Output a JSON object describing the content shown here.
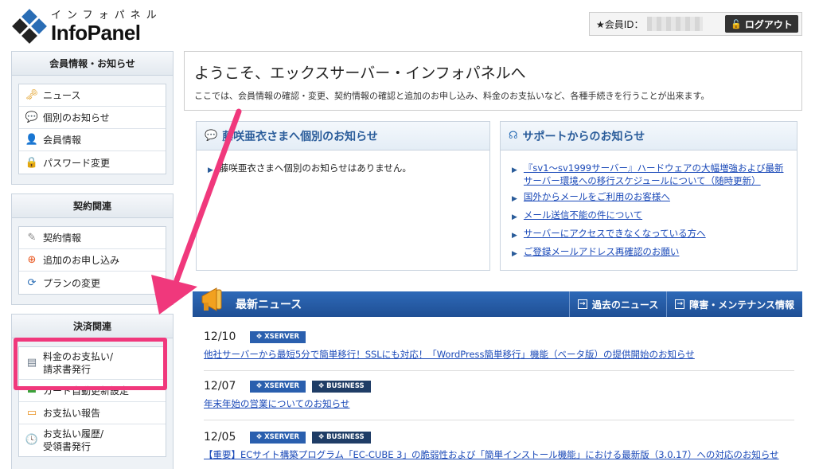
{
  "header": {
    "logo_kana": "インフォパネル",
    "logo_name": "InfoPanel",
    "member_label": "★会員ID：",
    "logout_label": "ログアウト"
  },
  "sidebar": {
    "sections": [
      {
        "title": "会員情報・お知らせ",
        "items": [
          {
            "label": "ニュース",
            "icon": "key-icon"
          },
          {
            "label": "個別のお知らせ",
            "icon": "speech-bubble-icon"
          },
          {
            "label": "会員情報",
            "icon": "user-icon"
          },
          {
            "label": "パスワード変更",
            "icon": "padlock-icon"
          }
        ]
      },
      {
        "title": "契約関連",
        "items": [
          {
            "label": "契約情報",
            "icon": "contract-icon"
          },
          {
            "label": "追加のお申し込み",
            "icon": "add-circle-icon"
          },
          {
            "label": "プランの変更",
            "icon": "refresh-icon"
          }
        ]
      },
      {
        "title": "決済関連",
        "items": [
          {
            "label1": "料金のお支払い/",
            "label2": "請求書発行",
            "icon": "invoice-icon"
          },
          {
            "label": "カード自動更新設定",
            "icon": "card-icon"
          },
          {
            "label": "お支払い報告",
            "icon": "report-icon"
          },
          {
            "label1": "お支払い履歴/",
            "label2": "受領書発行",
            "icon": "clock-icon"
          }
        ]
      }
    ]
  },
  "welcome": {
    "title": "ようこそ、エックスサーバー・インフォパネルへ",
    "text": "ここでは、会員情報の確認・変更、契約情報の確認と追加のお申し込み、料金のお支払いなど、各種手続きを行うことが出来ます。"
  },
  "personal_notice": {
    "title": "藤咲亜衣さまへ個別のお知らせ",
    "items": [
      "藤咲亜衣さまへ個別のお知らせはありません。"
    ]
  },
  "support_notice": {
    "title": "サポートからのお知らせ",
    "items": [
      "『sv1～sv1999サーバー』ハードウェアの大幅増強および最新サーバー環境への移行スケジュールについて（随時更新）",
      "国外からメールをご利用のお客様へ",
      "メール送信不能の件について",
      "サーバーにアクセスできなくなっている方へ",
      "ご登録メールアドレス再確認のお願い"
    ]
  },
  "news": {
    "title": "最新ニュース",
    "past_button": "過去のニュース",
    "maintenance_button": "障害・メンテナンス情報",
    "items": [
      {
        "date": "12/10",
        "tags": [
          "XSERVER"
        ],
        "text": "他社サーバーから最短5分で簡単移行！SSLにも対応！「WordPress簡単移行」機能（ベータ版）の提供開始のお知らせ"
      },
      {
        "date": "12/07",
        "tags": [
          "XSERVER",
          "BUSINESS"
        ],
        "text": "年末年始の営業についてのお知らせ"
      },
      {
        "date": "12/05",
        "tags": [
          "XSERVER",
          "BUSINESS"
        ],
        "text": "【重要】ECサイト構築プログラム「EC-CUBE 3」の脆弱性および「簡単インストール機能」における最新版（3.0.17）への対応のお知らせ"
      }
    ]
  },
  "colors": {
    "annotation": "#f0387c",
    "news_bar": "#2a5fae",
    "link": "#1a49b8"
  }
}
